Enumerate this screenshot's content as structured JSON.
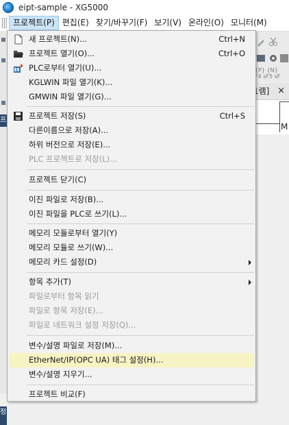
{
  "window": {
    "title": "eipt-sample - XG5000"
  },
  "menubar": {
    "items": [
      "프로젝트(P)",
      "편집(E)",
      "찾기/바꾸기(F)",
      "보기(V)",
      "온라인(O)",
      "모니터(M)"
    ]
  },
  "background": {
    "fkeys_line1": "F4 sF5 sF",
    "fkeys_line2": "{P} {N}",
    "panel_title": "1램]",
    "panel_close": "×",
    "grid_text": "M",
    "left_tab1": "프",
    "left_tab2": "정"
  },
  "menu": {
    "new_project": {
      "label": "새 프로젝트(N)...",
      "shortcut": "Ctrl+N"
    },
    "open_project": {
      "label": "프로젝트 열기(O)...",
      "shortcut": "Ctrl+O"
    },
    "open_from_plc": {
      "label": "PLC로부터 열기(U)..."
    },
    "open_kglwin": {
      "label": "KGLWIN 파일 열기(K)..."
    },
    "open_gmwin": {
      "label": "GMWIN 파일 열기(G)..."
    },
    "save_project": {
      "label": "프로젝트 저장(S)",
      "shortcut": "Ctrl+S"
    },
    "save_as": {
      "label": "다른이름으로 저장(A)..."
    },
    "save_lower_version": {
      "label": "하위 버전으로 저장(E)..."
    },
    "save_plc_project": {
      "label": "PLC 프로젝트로 저장(L)..."
    },
    "close_project": {
      "label": "프로젝트 닫기(C)"
    },
    "save_binary": {
      "label": "이진 파일로 저장(B)..."
    },
    "write_binary_plc": {
      "label": "이진 파일을 PLC로 쓰기(L)..."
    },
    "open_from_memory_module": {
      "label": "메모리 모듈로부터 열기(Y)"
    },
    "write_memory_module": {
      "label": "메모리 모듈로 쓰기(W)..."
    },
    "memory_card_settings": {
      "label": "메모리 카드 설정(D)"
    },
    "add_item": {
      "label": "항목 추가(T)"
    },
    "read_item_from_file": {
      "label": "파일로부터 항목 읽기"
    },
    "save_item_to_file": {
      "label": "파일로 항목 저장(E)..."
    },
    "save_network_settings": {
      "label": "파일로 네트워크 설정 저장(Q)..."
    },
    "save_variable_description": {
      "label": "변수/설명 파일로 저장(M)..."
    },
    "ethernet_ip_tag_settings": {
      "label": "EtherNet/IP(OPC UA) 태그 설정(H)..."
    },
    "clear_variable_description": {
      "label": "변수/설명 지우기..."
    },
    "compare_project": {
      "label": "프로젝트 비교(F)"
    }
  }
}
